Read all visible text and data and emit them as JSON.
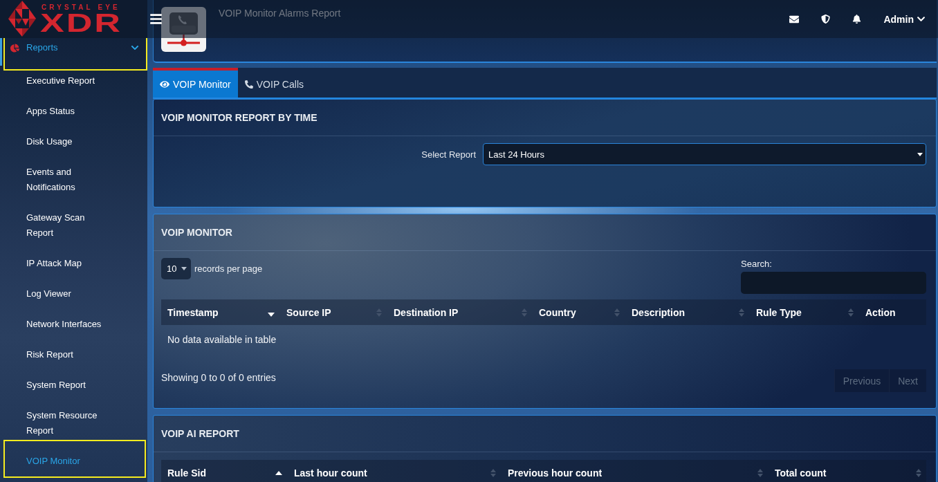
{
  "topbar": {
    "brand_tagline": "CRYSTAL EYE",
    "brand_name": "XDR",
    "user": "Admin"
  },
  "sidebar": {
    "section": {
      "label": "Reports",
      "active": true,
      "expanded": true,
      "highlighted": true
    },
    "items": [
      {
        "label": "Executive Report",
        "selected": false,
        "highlighted": false
      },
      {
        "label": "Apps Status",
        "selected": false,
        "highlighted": false
      },
      {
        "label": "Disk Usage",
        "selected": false,
        "highlighted": false
      },
      {
        "label": "Events and Notifications",
        "selected": false,
        "highlighted": false
      },
      {
        "label": "Gateway Scan Report",
        "selected": false,
        "highlighted": false
      },
      {
        "label": "IP Attack Map",
        "selected": false,
        "highlighted": false
      },
      {
        "label": "Log Viewer",
        "selected": false,
        "highlighted": false
      },
      {
        "label": "Network Interfaces",
        "selected": false,
        "highlighted": false
      },
      {
        "label": "Risk Report",
        "selected": false,
        "highlighted": false
      },
      {
        "label": "System Report",
        "selected": false,
        "highlighted": false
      },
      {
        "label": "System Resource Report",
        "selected": false,
        "highlighted": false
      },
      {
        "label": "VOIP Monitor",
        "selected": true,
        "highlighted": true
      }
    ]
  },
  "page_header": {
    "title": "VOIP Monitor Alarms Report"
  },
  "tabs": [
    {
      "label": "VOIP Monitor",
      "selected": true
    },
    {
      "label": "VOIP Calls",
      "selected": false
    }
  ],
  "report_by_time": {
    "title": "VOIP MONITOR REPORT BY TIME",
    "select_label": "Select Report",
    "select_value": "Last 24 Hours"
  },
  "monitor": {
    "title": "VOIP MONITOR",
    "page_length": "10",
    "length_label": "records per page",
    "search_label": "Search:",
    "columns": [
      {
        "label": "Timestamp",
        "sortable": true,
        "sorted": true,
        "ascending": false
      },
      {
        "label": "Source IP",
        "sortable": true,
        "sorted": false
      },
      {
        "label": "Destination IP",
        "sortable": true,
        "sorted": false
      },
      {
        "label": "Country",
        "sortable": true,
        "sorted": false
      },
      {
        "label": "Description",
        "sortable": true,
        "sorted": false
      },
      {
        "label": "Rule Type",
        "sortable": true,
        "sorted": false
      },
      {
        "label": "Action",
        "sortable": false
      }
    ],
    "empty_message": "No data available in table",
    "info": "Showing 0 to 0 of 0 entries",
    "pagination": [
      {
        "label": "Previous",
        "disabled": true
      },
      {
        "label": "Next",
        "disabled": true
      }
    ]
  },
  "ai_report": {
    "title": "VOIP AI REPORT",
    "columns": [
      {
        "label": "Rule Sid",
        "sortable": true,
        "sorted": true,
        "ascending": true
      },
      {
        "label": "Last hour count",
        "sortable": true,
        "sorted": false
      },
      {
        "label": "Previous hour count",
        "sortable": true,
        "sorted": false
      },
      {
        "label": "Total count",
        "sortable": true,
        "sorted": false
      }
    ]
  }
}
